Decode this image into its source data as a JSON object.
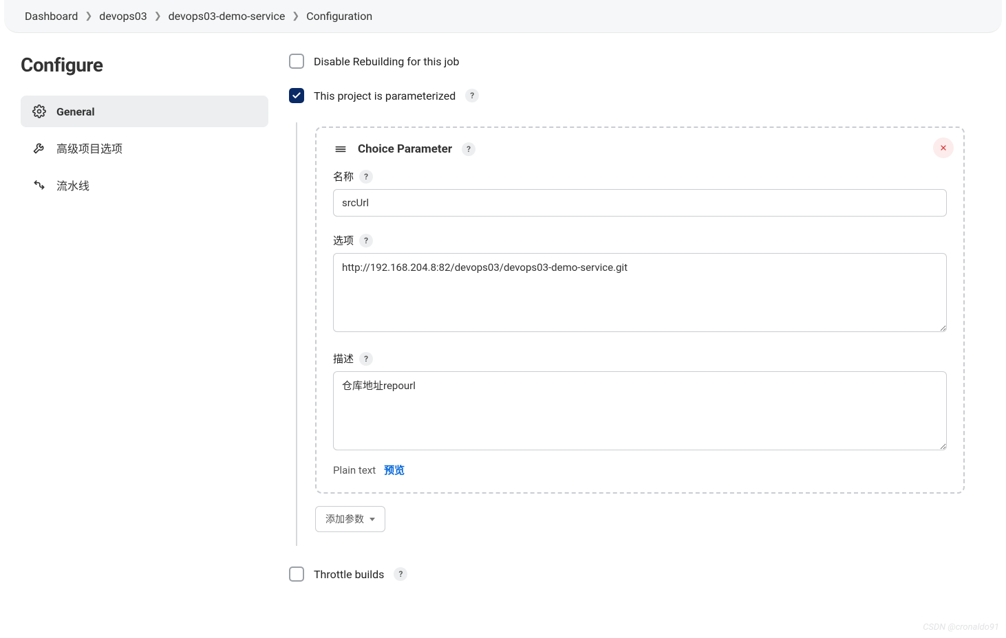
{
  "breadcrumb": {
    "items": [
      "Dashboard",
      "devops03",
      "devops03-demo-service",
      "Configuration"
    ]
  },
  "page": {
    "title": "Configure"
  },
  "sidebar": {
    "items": [
      {
        "label": "General",
        "active": true
      },
      {
        "label": "高级项目选项",
        "active": false
      },
      {
        "label": "流水线",
        "active": false
      }
    ]
  },
  "options": {
    "disable_rebuild": {
      "label": "Disable Rebuilding for this job",
      "checked": false
    },
    "parameterized": {
      "label": "This project is parameterized",
      "checked": true
    },
    "throttle": {
      "label": "Throttle builds",
      "checked": false
    }
  },
  "parameter_card": {
    "title": "Choice Parameter",
    "fields": {
      "name": {
        "label": "名称",
        "value": "srcUrl"
      },
      "choices": {
        "label": "选项",
        "value": "http://192.168.204.8:82/devops03/devops03-demo-service.git"
      },
      "description": {
        "label": "描述",
        "value": "仓库地址repourl"
      }
    },
    "format": {
      "plain": "Plain text",
      "preview": "预览"
    }
  },
  "buttons": {
    "add_param": "添加参数"
  },
  "watermark": "CSDN @cronaldo91"
}
